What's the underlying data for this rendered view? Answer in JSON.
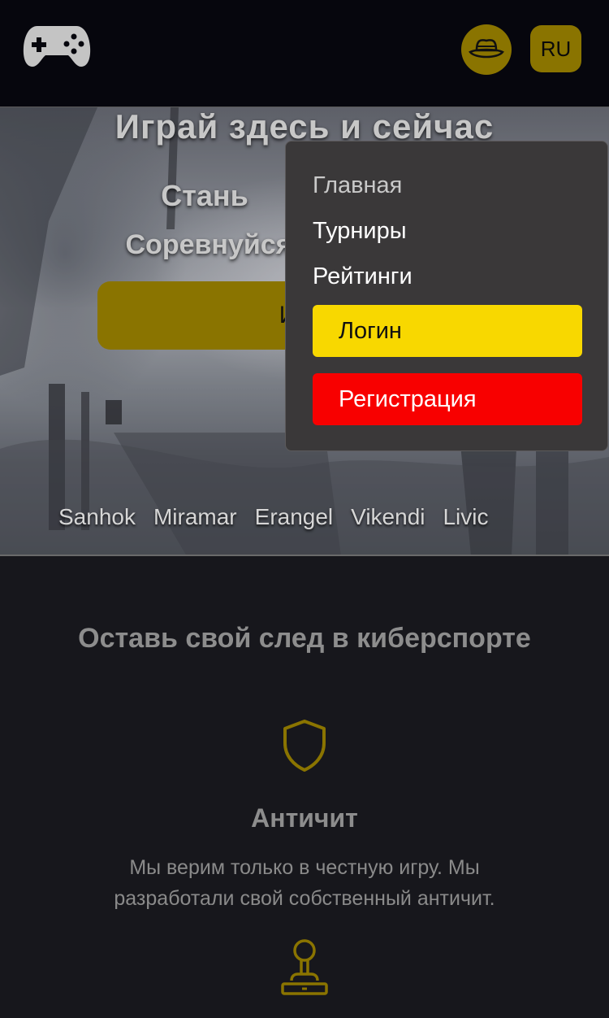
{
  "header": {
    "logo_icon": "gamepad-icon",
    "avatar_icon": "hat-icon",
    "lang_label": "RU",
    "accent_color": "#8a7400"
  },
  "hero": {
    "title": "Играй здесь и сейчас",
    "line2": "Стань",
    "line3": "Соревнуйся",
    "play_button_label": "Иг",
    "maps": [
      "Sanhok",
      "Miramar",
      "Erangel",
      "Vikendi",
      "Livic"
    ]
  },
  "menu": {
    "items": [
      {
        "label": "Главная"
      },
      {
        "label": "Турниры"
      },
      {
        "label": "Рейтинги"
      }
    ],
    "login_label": "Логин",
    "register_label": "Регистрация",
    "login_color": "#f8d800",
    "register_color": "#f80000"
  },
  "features": {
    "section_title": "Оставь свой след в киберспорте",
    "items": [
      {
        "icon": "shield-icon",
        "title": "Античит",
        "description": "Мы верим только в честную игру. Мы разработали свой собственный античит."
      },
      {
        "icon": "joystick-icon"
      }
    ]
  }
}
